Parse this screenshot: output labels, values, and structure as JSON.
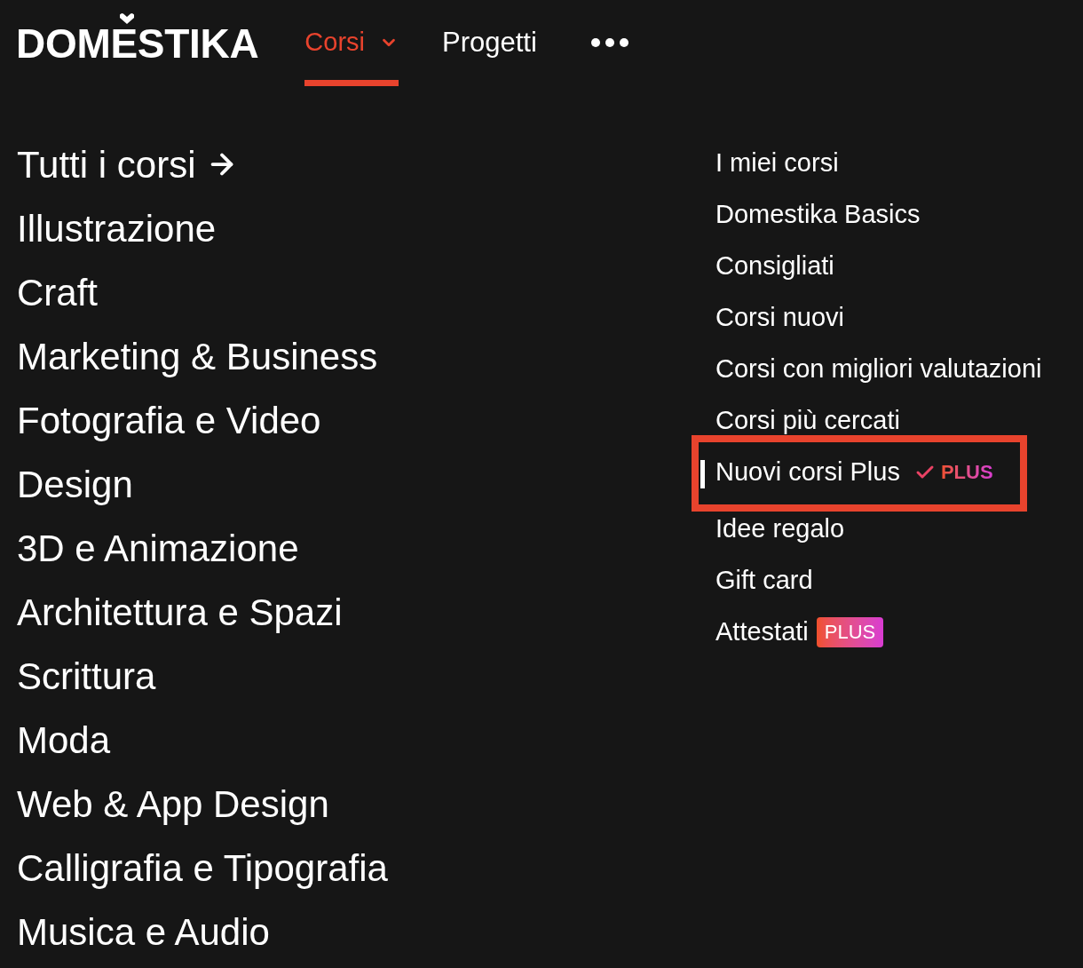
{
  "header": {
    "logo": {
      "text": "DOMESTIKA"
    },
    "nav": [
      {
        "kind": "dropdown",
        "label": "Corsi",
        "selected": true
      },
      {
        "kind": "link",
        "label": "Progetti",
        "selected": false
      },
      {
        "kind": "more",
        "selected": false
      }
    ]
  },
  "categories": [
    {
      "kind": "all",
      "label": "Tutti i corsi"
    },
    {
      "kind": "category",
      "label": "Illustrazione"
    },
    {
      "kind": "category",
      "label": "Craft"
    },
    {
      "kind": "category",
      "label": "Marketing & Business"
    },
    {
      "kind": "category",
      "label": "Fotografia e Video"
    },
    {
      "kind": "category",
      "label": "Design"
    },
    {
      "kind": "category",
      "label": "3D e Animazione"
    },
    {
      "kind": "category",
      "label": "Architettura e Spazi"
    },
    {
      "kind": "category",
      "label": "Scrittura"
    },
    {
      "kind": "category",
      "label": "Moda"
    },
    {
      "kind": "category",
      "label": "Web & App Design"
    },
    {
      "kind": "category",
      "label": "Calligrafia e Tipografia"
    },
    {
      "kind": "category",
      "label": "Musica e Audio"
    }
  ],
  "links": [
    {
      "label": "I miei corsi",
      "highlighted": false
    },
    {
      "label": "Domestika Basics",
      "highlighted": false
    },
    {
      "label": "Consigliati",
      "highlighted": false
    },
    {
      "label": "Corsi nuovi",
      "highlighted": false
    },
    {
      "label": "Corsi con migliori valutazioni",
      "highlighted": false
    },
    {
      "label": "Corsi più cercati",
      "highlighted": false
    },
    {
      "label": "Nuovi corsi Plus",
      "highlighted": true,
      "badge": {
        "kind": "check",
        "text": "PLUS"
      }
    },
    {
      "label": "Idee regalo",
      "highlighted": false
    },
    {
      "label": "Gift card",
      "highlighted": false
    },
    {
      "label": "Attestati",
      "highlighted": false,
      "badge": {
        "kind": "tag",
        "text": "PLUS"
      }
    }
  ]
}
